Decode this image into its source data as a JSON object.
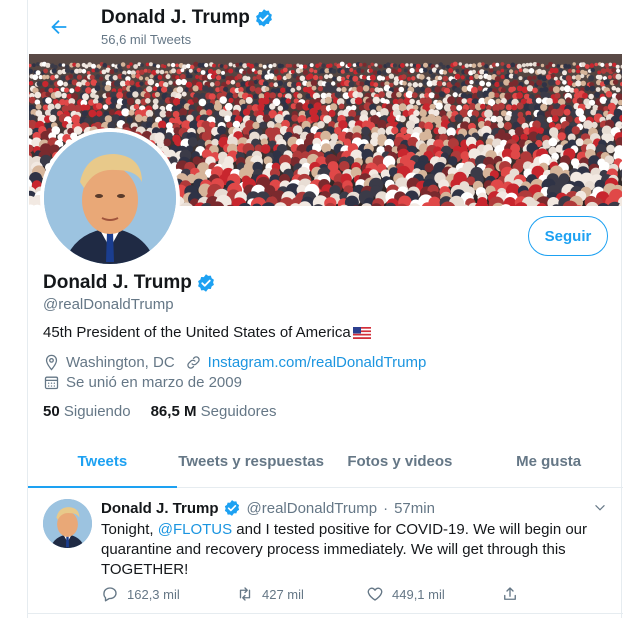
{
  "header": {
    "name": "Donald J. Trump",
    "tweet_count": "56,6 mil Tweets"
  },
  "profile": {
    "name": "Donald J. Trump",
    "handle": "@realDonaldTrump",
    "bio": "45th President of the United States of America",
    "location": "Washington, DC",
    "website": "Instagram.com/realDonaldTrump",
    "joined": "Se unió en marzo de 2009",
    "following_count": "50",
    "following_label": "Siguiendo",
    "followers_count": "86,5 M",
    "followers_label": "Seguidores",
    "follow_button": "Seguir"
  },
  "tabs": [
    {
      "label": "Tweets",
      "active": true
    },
    {
      "label": "Tweets y respuestas",
      "active": false
    },
    {
      "label": "Fotos y videos",
      "active": false
    },
    {
      "label": "Me gusta",
      "active": false
    }
  ],
  "tweet": {
    "name": "Donald J. Trump",
    "handle": "@realDonaldTrump",
    "separator": "·",
    "time": "57min",
    "text_before": "Tonight, ",
    "mention": "@FLOTUS",
    "text_after": " and I tested positive for COVID-19. We will begin our quarantine and recovery process immediately. We will get through this TOGETHER!",
    "replies": "162,3 mil",
    "retweets": "427 mil",
    "likes": "449,1 mil"
  },
  "colors": {
    "accent": "#1da1f2",
    "link": "#1b95e0",
    "secondary_text": "#657786"
  }
}
